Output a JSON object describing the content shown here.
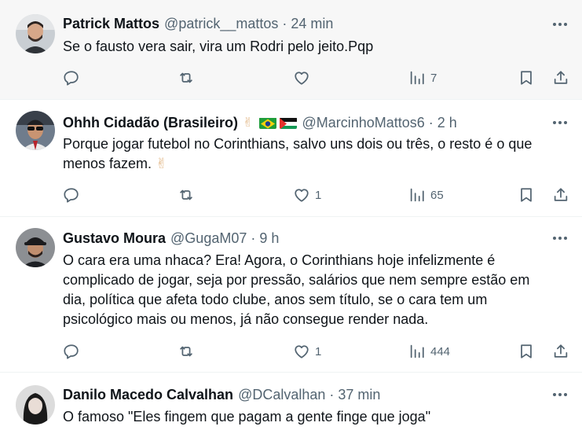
{
  "tweets": [
    {
      "name": "Patrick Mattos",
      "handle": "@patrick__mattos",
      "separator": "·",
      "time": "24 min",
      "lines": [
        "Se o fausto vera sair, vira um Rodri pelo jeito.Pqp"
      ],
      "replies": "",
      "retweets": "",
      "likes": "",
      "views": "7",
      "avatar_icon": "avatar-man-beard"
    },
    {
      "name": "Ohhh Cidadão (Brasileiro)",
      "name_emoji": "✌",
      "flags": [
        "brazil-flag",
        "palestine-flag"
      ],
      "handle": "@MarcinhoMattos6",
      "separator": "·",
      "time": "2 h",
      "lines": [
        "Porque jogar futebol no Corinthians, salvo uns dois ou três, o resto é o que",
        "menos fazem."
      ],
      "text_emoji": "✌",
      "replies": "",
      "retweets": "",
      "likes": "1",
      "views": "65",
      "avatar_icon": "avatar-man-sunglasses"
    },
    {
      "name": "Gustavo Moura",
      "handle": "@GugaM07",
      "separator": "·",
      "time": "9 h",
      "lines": [
        "O cara era uma nhaca? Era! Agora, o Corinthians hoje infelizmente é",
        "complicado de jogar, seja por pressão, salários que nem sempre estão em",
        "dia, política que afeta todo clube, anos sem título, se o cara tem um",
        "psicológico mais ou menos, já não consegue render nada."
      ],
      "replies": "",
      "retweets": "",
      "likes": "1",
      "views": "444",
      "avatar_icon": "avatar-man-cap"
    },
    {
      "name": "Danilo Macedo Calvalhan",
      "handle": "@DCalvalhan",
      "separator": "·",
      "time": "37 min",
      "lines": [
        "O famoso \"Eles fingem que pagam a gente finge que joga\""
      ],
      "avatar_icon": "avatar-woman-dark-hair"
    }
  ],
  "colors": {
    "text": "#0f1419",
    "secondary": "#536471",
    "highlight_bg": "#f7f7f7",
    "divider": "#eff3f4"
  }
}
